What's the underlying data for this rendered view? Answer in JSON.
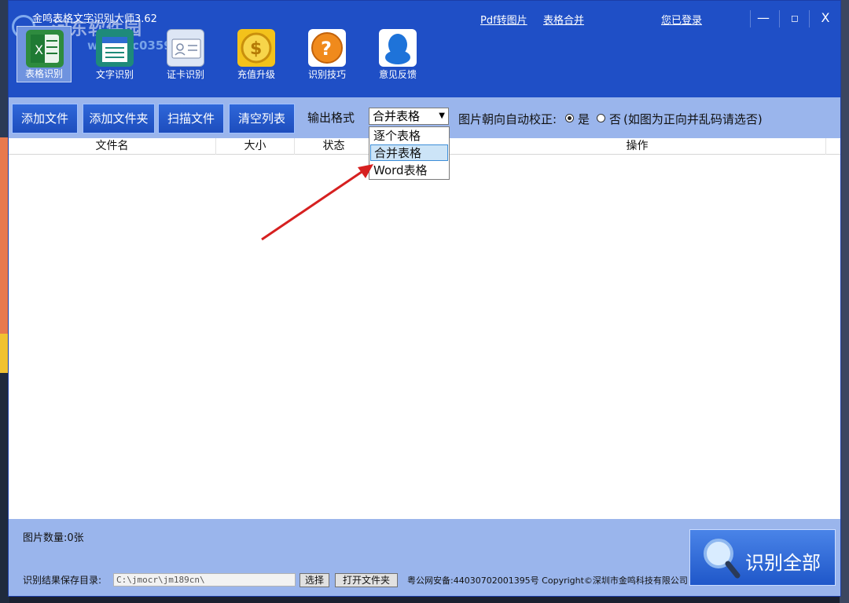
{
  "window": {
    "title": "金鸣表格文字识别大师3.62",
    "watermark": "河东软件园",
    "watermark_url": "www.pc0359.cn"
  },
  "top_links": {
    "pdf_to_image": "Pdf转图片",
    "table_merge": "表格合并",
    "login_status": "您已登录"
  },
  "window_controls": {
    "minimize": "—",
    "maximize": "◻",
    "close": "X"
  },
  "toolbar": {
    "items": [
      {
        "label": "表格识别",
        "icon": "excel-icon",
        "active": true,
        "color": "#2e8b3e"
      },
      {
        "label": "文字识别",
        "icon": "document-icon",
        "active": false,
        "color": "#1e8a7a"
      },
      {
        "label": "证卡识别",
        "icon": "id-card-icon",
        "active": false,
        "color": "#dde6f5"
      },
      {
        "label": "充值升级",
        "icon": "coin-icon",
        "active": false,
        "color": "#f3c21b"
      },
      {
        "label": "识别技巧",
        "icon": "help-icon",
        "active": false,
        "color": "#f08a1c"
      },
      {
        "label": "意见反馈",
        "icon": "qq-icon",
        "active": false,
        "color": "#1e73d9"
      }
    ]
  },
  "actions": {
    "add_file": "添加文件",
    "add_folder": "添加文件夹",
    "scan_file": "扫描文件",
    "clear_list": "清空列表"
  },
  "output_format": {
    "label": "输出格式",
    "selected": "合并表格",
    "options": [
      "逐个表格",
      "合并表格",
      "Word表格"
    ],
    "hovered_index": 1
  },
  "orientation": {
    "label": "图片朝向自动校正:",
    "yes": "是",
    "no": "否",
    "note": "(如图为正向并乱码请选否)",
    "selected": "yes"
  },
  "table": {
    "columns": [
      "文件名",
      "大小",
      "状态",
      "",
      "操作"
    ],
    "rows": []
  },
  "footer": {
    "image_count": "图片数量:0张",
    "save_dir_label": "识别结果保存目录:",
    "save_dir_value": "C:\\jmocr\\jm189cn\\",
    "choose_button": "选择",
    "open_folder_button": "打开文件夹",
    "copyright": "粤公网安备:44030702001395号 Copyright©深圳市金鸣科技有限公司",
    "recognize_all": "识别全部"
  },
  "colors": {
    "title_bar": "#1f4fc6",
    "panel": "#9ab5ec",
    "button": "#1d4dbd",
    "annotation_arrow": "#d62020"
  }
}
